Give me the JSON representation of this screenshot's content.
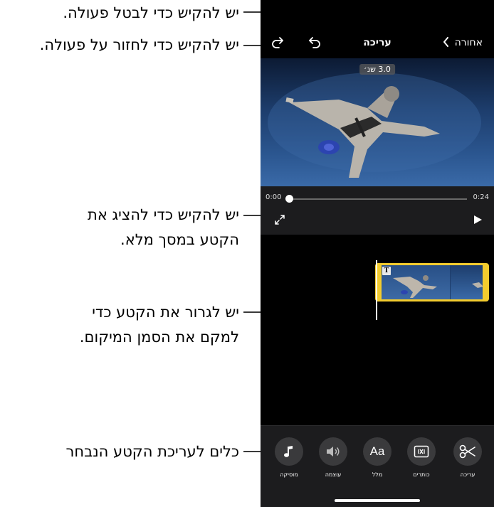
{
  "callouts": {
    "undo": "יש להקיש כדי לבטל פעולה.",
    "redo": "יש להקיש כדי לחזור על פעולה.",
    "fullscreen_line1": "יש להקיש כדי להציג את",
    "fullscreen_line2": "הקטע במסך מלא.",
    "drag_line1": "יש לגרור את הקטע כדי",
    "drag_line2": "למקם את הסמן המיקום.",
    "tools": "כלים לעריכת הקטע הנבחר"
  },
  "nav": {
    "back_label": "אחורה",
    "title": "עריכה",
    "redo_icon": "redo-icon",
    "undo_icon": "undo-icon"
  },
  "video": {
    "clip_duration": "3.0 שנ׳",
    "current_time": "0:00",
    "total_time": "0:24",
    "progress": 0
  },
  "timeline": {
    "title_badge": "T"
  },
  "toolbar": {
    "tools": [
      {
        "label": "עריכה",
        "icon": "scissors-icon"
      },
      {
        "label": "כותרים",
        "icon": "titles-icon"
      },
      {
        "label": "מלל",
        "icon": "text-icon",
        "glyph": "Aa"
      },
      {
        "label": "עוצמה",
        "icon": "volume-icon"
      },
      {
        "label": "מוסיקה",
        "icon": "music-icon"
      }
    ]
  },
  "colors": {
    "clip_border": "#f3cc2e",
    "toolbar_bg": "#1c1c1e",
    "tool_circle": "#3a3a3c"
  }
}
